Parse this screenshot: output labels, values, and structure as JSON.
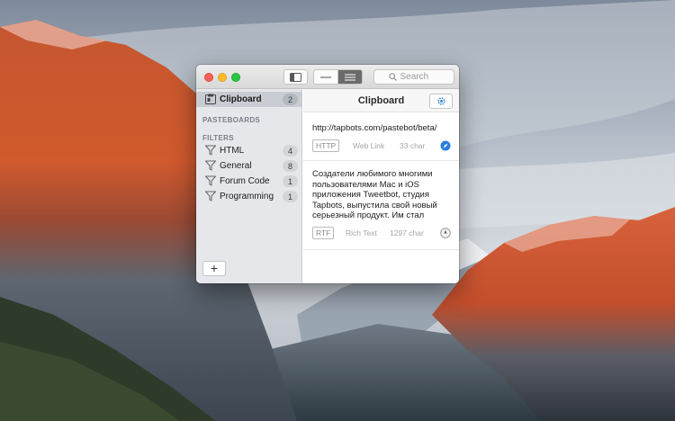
{
  "window": {
    "toolbar": {
      "sidebar_toggle_icon": "sidebar-icon",
      "view_segments": [
        {
          "icon": "single-line-view-icon",
          "active": false
        },
        {
          "icon": "list-view-icon",
          "active": true
        }
      ],
      "search_placeholder": "Search"
    },
    "sidebar": {
      "clipboard": {
        "label": "Clipboard",
        "count": "2",
        "icon": "clipboard-icon"
      },
      "pasteboards_header": "PASTEBOARDS",
      "filters_header": "FILTERS",
      "filters": [
        {
          "label": "HTML",
          "count": "4",
          "icon": "filter-funnel-icon"
        },
        {
          "label": "General",
          "count": "8",
          "icon": "filter-funnel-icon"
        },
        {
          "label": "Forum Code",
          "count": "1",
          "icon": "filter-funnel-icon"
        },
        {
          "label": "Programming",
          "count": "1",
          "icon": "filter-funnel-icon"
        }
      ],
      "add_label": "+"
    },
    "content": {
      "title": "Clipboard",
      "settings_icon": "gear-icon",
      "clips": [
        {
          "text": "http://tapbots.com/pastebot/beta/",
          "type": "HTTP",
          "kind": "Web Link",
          "size": "33 char",
          "app_icon": "safari-compass-icon"
        },
        {
          "text": "Создатели любимого многими пользователями Mac и iOS приложения Tweetbot, студия Tapbots, выпустила свой новый серьезный продукт. Им стал менед…",
          "type": "RTF",
          "kind": "Rich Text",
          "size": "1297 char",
          "app_icon": "app-icon"
        }
      ]
    }
  },
  "colors": {
    "sidebar_bg": "#e4e6ea",
    "selected_row": "#c9ccd2",
    "close": "#fc5f57",
    "minimize": "#fdbc2e",
    "maximize": "#28c840",
    "link_icon": "#2a7fdc"
  }
}
